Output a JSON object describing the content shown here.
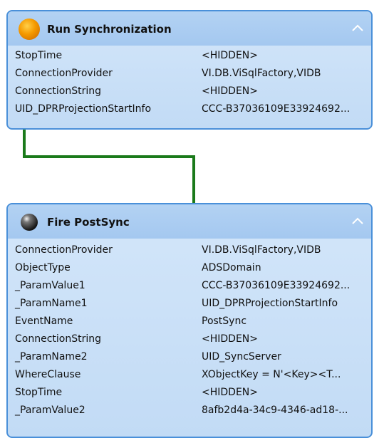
{
  "colors": {
    "node_border": "#4a90d9",
    "node_body": "#c6ddf6",
    "node_header": "#a9cbf1",
    "connector": "#1a7a1a",
    "run_icon": "#f59a00",
    "fire_icon": "#222222"
  },
  "node_run": {
    "icon": "orange-circle-icon",
    "title": "Run Synchronization",
    "rows": [
      {
        "key": "StopTime",
        "value": "<HIDDEN>"
      },
      {
        "key": "ConnectionProvider",
        "value": "VI.DB.ViSqlFactory,VIDB"
      },
      {
        "key": "ConnectionString",
        "value": "<HIDDEN>"
      },
      {
        "key": "UID_DPRProjectionStartInfo",
        "value": "CCC-B37036109E33924692..."
      }
    ]
  },
  "node_fire": {
    "icon": "black-sphere-icon",
    "title": "Fire PostSync",
    "rows": [
      {
        "key": "ConnectionProvider",
        "value": "VI.DB.ViSqlFactory,VIDB"
      },
      {
        "key": "ObjectType",
        "value": "ADSDomain"
      },
      {
        "key": "_ParamValue1",
        "value": "CCC-B37036109E33924692..."
      },
      {
        "key": "_ParamName1",
        "value": "UID_DPRProjectionStartInfo"
      },
      {
        "key": "EventName",
        "value": "PostSync"
      },
      {
        "key": "ConnectionString",
        "value": "<HIDDEN>"
      },
      {
        "key": "_ParamName2",
        "value": "UID_SyncServer"
      },
      {
        "key": "WhereClause",
        "value": "XObjectKey = N'<Key><T..."
      },
      {
        "key": "StopTime",
        "value": "<HIDDEN>"
      },
      {
        "key": "_ParamValue2",
        "value": "8afb2d4a-34c9-4346-ad18-..."
      }
    ]
  }
}
